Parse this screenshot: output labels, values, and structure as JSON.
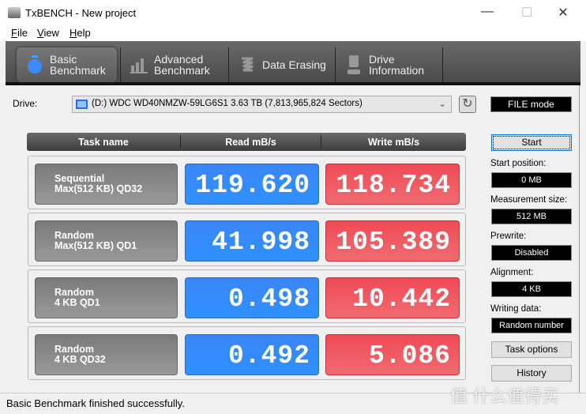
{
  "window": {
    "title": "TxBENCH - New project",
    "minimize": "—",
    "maximize": "☐",
    "close": "✕"
  },
  "menu": [
    {
      "key": "F",
      "rest": "ile"
    },
    {
      "key": "V",
      "rest": "iew"
    },
    {
      "key": "H",
      "rest": "elp"
    }
  ],
  "tabs": [
    {
      "l1": "Basic",
      "l2": "Benchmark",
      "icon": "stopwatch-icon",
      "active": true
    },
    {
      "l1": "Advanced",
      "l2": "Benchmark",
      "icon": "bar-chart-icon"
    },
    {
      "l1": "Data Erasing",
      "l2": "",
      "icon": "eraser-icon"
    },
    {
      "l1": "Drive",
      "l2": "Information",
      "icon": "drive-info-icon"
    }
  ],
  "drive": {
    "label": "Drive:",
    "value": "(D:) WDC WD40NMZW-59LG6S1  3.63 TB (7,813,965,824 Sectors)",
    "mode": "FILE mode"
  },
  "table": {
    "headers": [
      "Task name",
      "Read mB/s",
      "Write mB/s"
    ],
    "rows": [
      {
        "l1": "Sequential",
        "l2": "Max(512 KB) QD32",
        "read": "119.620",
        "write": "118.734"
      },
      {
        "l1": "Random",
        "l2": "Max(512 KB) QD1",
        "read": "41.998",
        "write": "105.389"
      },
      {
        "l1": "Random",
        "l2": "4 KB QD1",
        "read": "0.498",
        "write": "10.442"
      },
      {
        "l1": "Random",
        "l2": "4 KB QD32",
        "read": "0.492",
        "write": "5.086"
      }
    ]
  },
  "panel": {
    "start": "Start",
    "start_position_label": "Start position:",
    "start_position": "0 MB",
    "measurement_size_label": "Measurement size:",
    "measurement_size": "512 MB",
    "prewrite_label": "Prewrite:",
    "prewrite": "Disabled",
    "alignment_label": "Alignment:",
    "alignment": "4 KB",
    "writing_data_label": "Writing data:",
    "writing_data": "Random number",
    "task_options": "Task options",
    "history": "History"
  },
  "status": "Basic Benchmark finished successfully.",
  "watermark": "值 什么值得买",
  "colors": {
    "read": "#3b8af8",
    "write": "#ef525b",
    "toolbar": "#555555"
  }
}
